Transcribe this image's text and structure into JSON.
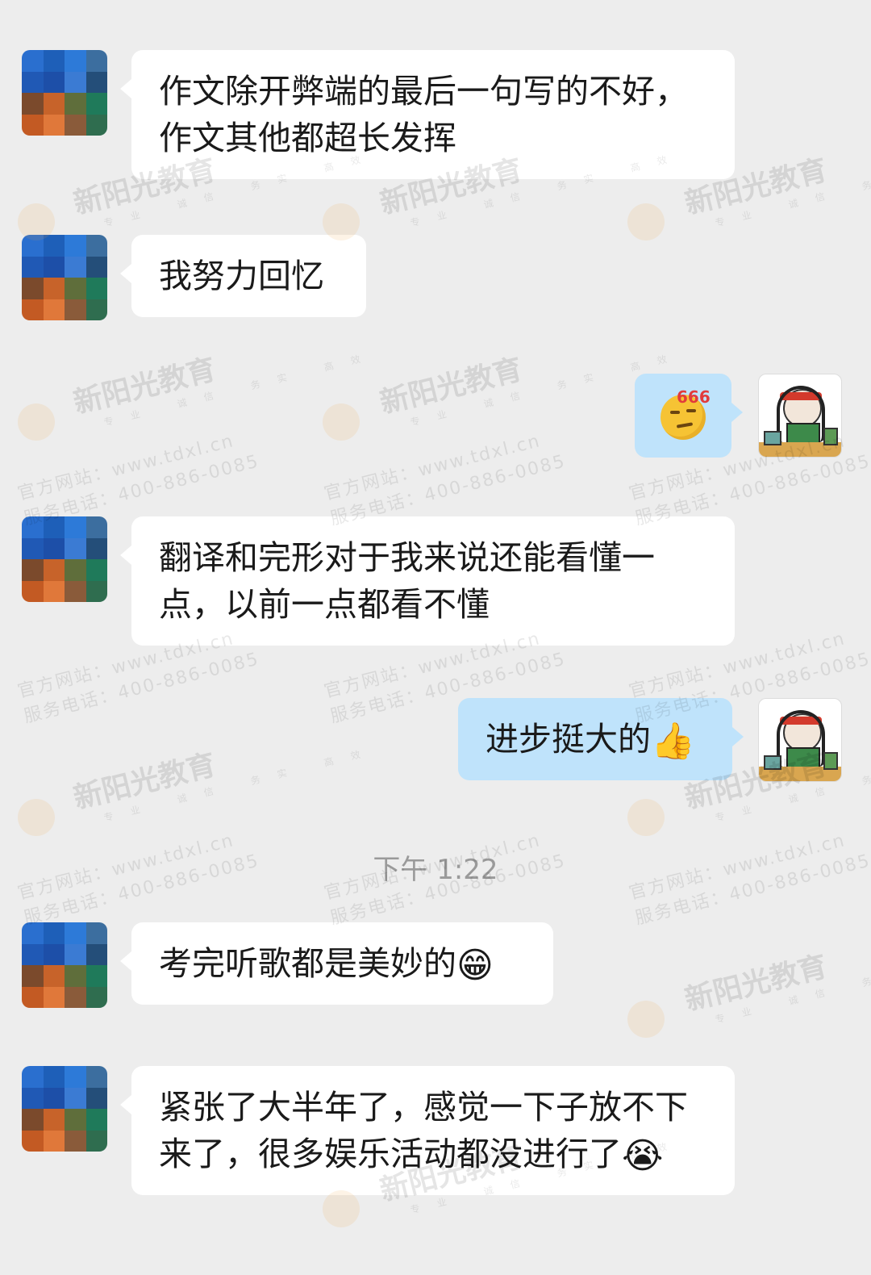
{
  "messages": [
    {
      "side": "in",
      "text": "作文除开弊端的最后一句写的不好，作文其他都超长发挥"
    },
    {
      "side": "in",
      "text": "我努力回忆"
    },
    {
      "side": "out",
      "text": "",
      "sticker": "666-smirk-emoji"
    },
    {
      "side": "in",
      "text": "翻译和完形对于我来说还能看懂一点，以前一点都看不懂"
    },
    {
      "side": "out",
      "text": "进步挺大的",
      "emoji": "👍"
    },
    {
      "side": "in",
      "text": "考完听歌都是美妙的",
      "emoji": "😁"
    },
    {
      "side": "in",
      "text": "紧张了大半年了，感觉一下子放不下来了，很多娱乐活动都没进行了",
      "emoji": "😭"
    }
  ],
  "timestamp": "下午 1:22",
  "sticker_badge": "666",
  "watermark": {
    "brand": "新阳光教育",
    "tags": "专业 诚信 务实 高效",
    "site": "官方网站：www.tdxl.cn",
    "phone": "服务电话：400-886-0085"
  },
  "colors": {
    "background": "#ededed",
    "incoming_bubble": "#ffffff",
    "outgoing_bubble": "#bfe3fb",
    "timestamp": "#9a9a9a"
  }
}
